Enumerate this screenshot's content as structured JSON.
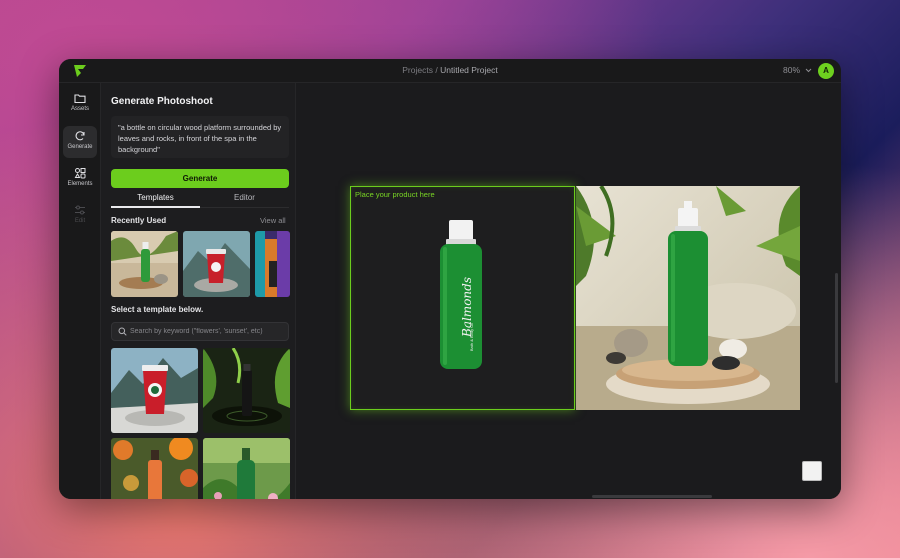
{
  "topbar": {
    "breadcrumb_root": "Projects",
    "breadcrumb_sep": " / ",
    "project_name": "Untitled Project",
    "zoom": "80%",
    "avatar_initial": "A"
  },
  "rail": {
    "items": [
      {
        "label": "Assets",
        "icon": "folder-icon"
      },
      {
        "label": "Generate",
        "icon": "refresh-icon"
      },
      {
        "label": "Elements",
        "icon": "shapes-icon"
      },
      {
        "label": "Edit",
        "icon": "sliders-icon"
      }
    ]
  },
  "panel": {
    "title": "Generate Photoshoot",
    "prompt": "\"a bottle on circular wood platform surrounded by leaves and rocks, in front of the spa in the background\"",
    "generate_label": "Generate",
    "tabs": [
      "Templates",
      "Editor"
    ],
    "recently_used_label": "Recently Used",
    "view_all_label": "View all",
    "select_template_label": "Select a template below.",
    "search_placeholder": "Search by keyword (\"flowers', 'sunset', etc)"
  },
  "canvas": {
    "drop_label": "Place your product here",
    "bottle_brand": "Balmonds",
    "bottle_subtitle": "Bath & Body Oil"
  },
  "colors": {
    "accent": "#6ccd1d",
    "window_bg": "#1d1d1f",
    "canvas_bg": "#1b1b1d"
  }
}
